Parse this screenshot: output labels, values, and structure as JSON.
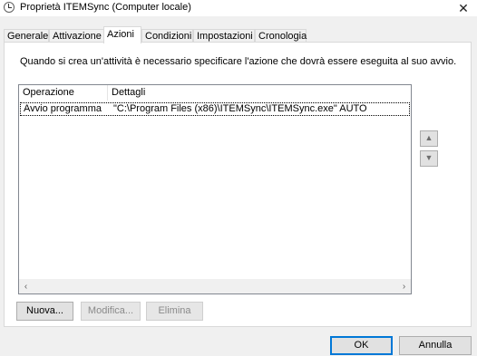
{
  "window": {
    "title": "Proprietà ITEMSync (Computer locale)",
    "close_glyph": "✕",
    "icon": "task-clock-icon"
  },
  "tabs": [
    {
      "label": "Generale",
      "selected": false
    },
    {
      "label": "Attivazione",
      "selected": false
    },
    {
      "label": "Azioni",
      "selected": true
    },
    {
      "label": "Condizioni",
      "selected": false
    },
    {
      "label": "Impostazioni",
      "selected": false
    },
    {
      "label": "Cronologia",
      "selected": false
    }
  ],
  "panel": {
    "info_text": "Quando si crea un'attività è necessario specificare l'azione che dovrà essere eseguita al suo avvio."
  },
  "actions_table": {
    "columns": [
      "Operazione",
      "Dettagli"
    ],
    "rows": [
      {
        "operazione": "Avvio programma",
        "dettagli": "\"C:\\Program Files (x86)\\ITEMSync\\ITEMSync.exe\" AUTO"
      }
    ]
  },
  "scroll": {
    "left_arrow": "‹",
    "right_arrow": "›"
  },
  "reorder": {
    "up_glyph": "▲",
    "down_glyph": "▼"
  },
  "buttons": {
    "new": "Nuova...",
    "edit": "Modifica...",
    "delete": "Elimina",
    "ok": "OK",
    "cancel": "Annulla"
  }
}
